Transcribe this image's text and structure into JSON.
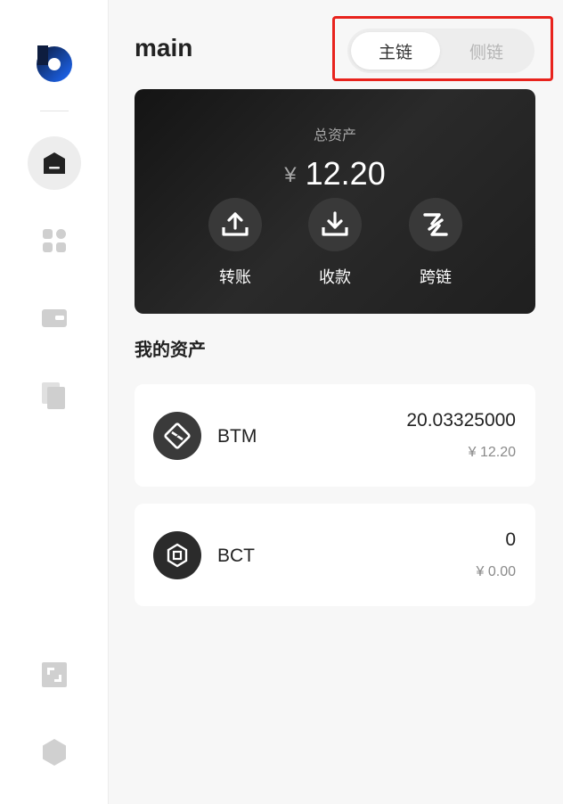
{
  "sidebar": {
    "items": [
      {
        "name": "home-icon",
        "active": true
      },
      {
        "name": "apps-icon",
        "active": false
      },
      {
        "name": "wallet-icon",
        "active": false
      },
      {
        "name": "copy-icon",
        "active": false
      }
    ],
    "bottom": [
      "expand-icon",
      "hexagon-icon"
    ]
  },
  "header": {
    "title": "main",
    "chain_toggle": {
      "main_label": "主链",
      "side_label": "侧链",
      "selected": "main"
    }
  },
  "balance": {
    "label": "总资产",
    "currency": "¥",
    "amount": "12.20",
    "actions": [
      {
        "label": "转账",
        "icon": "upload-icon"
      },
      {
        "label": "收款",
        "icon": "download-icon"
      },
      {
        "label": "跨链",
        "icon": "cross-chain-icon"
      }
    ]
  },
  "assets": {
    "title": "我的资产",
    "items": [
      {
        "symbol": "BTM",
        "amount": "20.03325000",
        "fiat": "¥ 12.20",
        "icon": "btm-token-icon"
      },
      {
        "symbol": "BCT",
        "amount": "0",
        "fiat": "¥ 0.00",
        "icon": "bct-token-icon"
      }
    ]
  },
  "colors": {
    "highlight": "#e8231d",
    "logo_blue": "#1f6bff",
    "card_dark": "#1c1c1c"
  }
}
